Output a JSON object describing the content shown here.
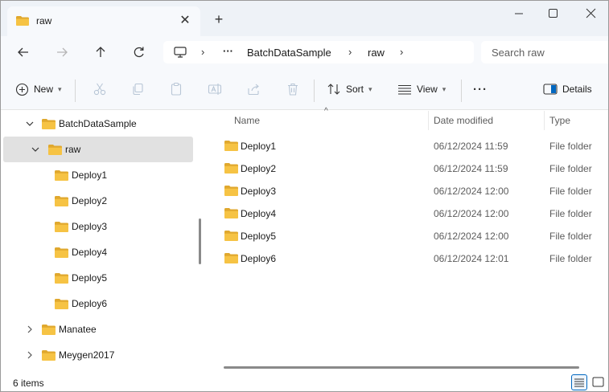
{
  "tab": {
    "title": "raw"
  },
  "window_controls": {
    "minimize": "—",
    "maximize": "☐",
    "close": "✕"
  },
  "address": {
    "ellipsis": "···",
    "crumbs": [
      "BatchDataSample",
      "raw"
    ],
    "separator": "›"
  },
  "search": {
    "placeholder": "Search raw"
  },
  "commands": {
    "new_label": "New",
    "sort_label": "Sort",
    "view_label": "View",
    "more_label": "···",
    "details_label": "Details"
  },
  "nav_tree": [
    {
      "label": "BatchDataSample",
      "expanded": true,
      "level": 0
    },
    {
      "label": "raw",
      "expanded": true,
      "level": 1,
      "selected": true
    },
    {
      "label": "Deploy1",
      "level": 2
    },
    {
      "label": "Deploy2",
      "level": 2
    },
    {
      "label": "Deploy3",
      "level": 2
    },
    {
      "label": "Deploy4",
      "level": 2
    },
    {
      "label": "Deploy5",
      "level": 2
    },
    {
      "label": "Deploy6",
      "level": 2
    },
    {
      "label": "Manatee",
      "expanded": false,
      "level": 0
    },
    {
      "label": "Meygen2017",
      "expanded": false,
      "level": 0
    }
  ],
  "columns": {
    "name": "Name",
    "date_modified": "Date modified",
    "type": "Type"
  },
  "files": [
    {
      "name": "Deploy1",
      "date": "06/12/2024 11:59",
      "type": "File folder"
    },
    {
      "name": "Deploy2",
      "date": "06/12/2024 11:59",
      "type": "File folder"
    },
    {
      "name": "Deploy3",
      "date": "06/12/2024 12:00",
      "type": "File folder"
    },
    {
      "name": "Deploy4",
      "date": "06/12/2024 12:00",
      "type": "File folder"
    },
    {
      "name": "Deploy5",
      "date": "06/12/2024 12:00",
      "type": "File folder"
    },
    {
      "name": "Deploy6",
      "date": "06/12/2024 12:01",
      "type": "File folder"
    }
  ],
  "status": {
    "item_count": "6 items"
  },
  "colors": {
    "folder": "#f6c344",
    "folder_dark": "#e0a82e",
    "accent": "#0067c0",
    "selection": "#e1e1e1"
  }
}
